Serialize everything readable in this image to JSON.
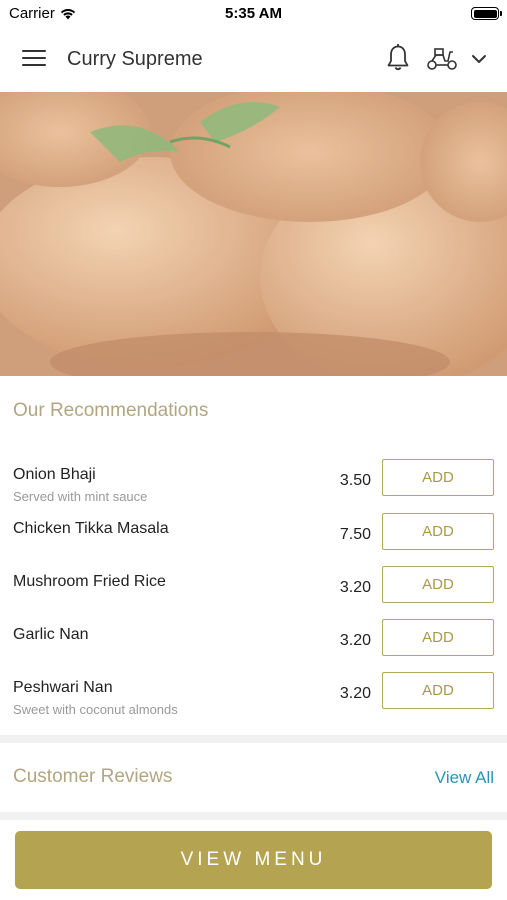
{
  "status_bar": {
    "carrier": "Carrier",
    "time": "5:35 AM"
  },
  "nav": {
    "title": "Curry Supreme"
  },
  "recommendations": {
    "title": "Our Recommendations",
    "items": [
      {
        "name": "Onion Bhaji",
        "description": "Served with mint sauce",
        "price": "3.50",
        "button": "ADD"
      },
      {
        "name": "Chicken Tikka Masala",
        "description": "",
        "price": "7.50",
        "button": "ADD"
      },
      {
        "name": "Mushroom Fried Rice",
        "description": "",
        "price": "3.20",
        "button": "ADD"
      },
      {
        "name": "Garlic Nan",
        "description": "",
        "price": "3.20",
        "button": "ADD"
      },
      {
        "name": "Peshwari Nan",
        "description": "Sweet with coconut almonds",
        "price": "3.20",
        "button": "ADD"
      }
    ]
  },
  "reviews": {
    "title": "Customer Reviews",
    "view_all": "View All"
  },
  "footer": {
    "view_menu": "VIEW MENU"
  },
  "colors": {
    "accent": "#b4a350",
    "link": "#2a93b5",
    "section_title": "#b2a680"
  }
}
